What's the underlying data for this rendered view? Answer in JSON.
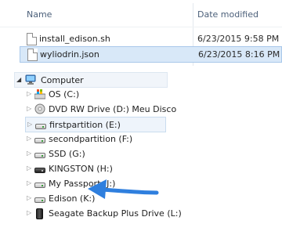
{
  "file_list": {
    "columns": {
      "name": "Name",
      "date_modified": "Date modified"
    },
    "rows": [
      {
        "name": "install_edison.sh",
        "date": "6/23/2015 9:58 PM",
        "selected": false
      },
      {
        "name": "wyliodrin.json",
        "date": "6/23/2015 8:16 PM",
        "selected": true
      }
    ]
  },
  "tree": {
    "root": {
      "label": "Computer",
      "icon": "computer-icon",
      "expanded": true
    },
    "items": [
      {
        "label": "OS (C:)",
        "icon": "os-drive-icon"
      },
      {
        "label": "DVD RW Drive (D:) Meu Disco",
        "icon": "dvd-drive-icon"
      },
      {
        "label": "firstpartition (E:)",
        "icon": "drive-icon",
        "selected": true
      },
      {
        "label": "secondpartition (F:)",
        "icon": "drive-icon"
      },
      {
        "label": "SSD (G:)",
        "icon": "drive-icon"
      },
      {
        "label": "KINGSTON (H:)",
        "icon": "dark-drive-icon"
      },
      {
        "label": "My Passport (J:)",
        "icon": "drive-icon"
      },
      {
        "label": "Edison (K:)",
        "icon": "drive-icon"
      },
      {
        "label": "Seagate Backup Plus Drive (L:)",
        "icon": "external-drive-icon"
      }
    ]
  },
  "annotation": {
    "arrow_color": "#2f7fde",
    "points_to": "Edison (K:)"
  },
  "colors": {
    "selection": "#d8e8f8",
    "selection_border": "#a9c8ea",
    "header_text": "#4c607a"
  }
}
